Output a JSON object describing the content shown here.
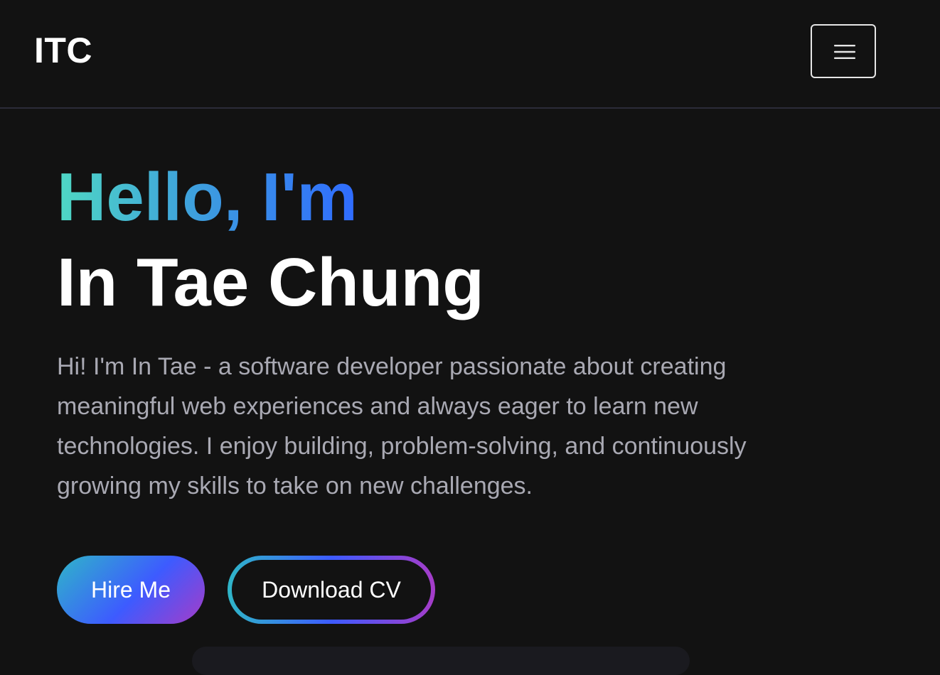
{
  "header": {
    "brand": "ITC",
    "menu_icon": "hamburger-menu-icon"
  },
  "hero": {
    "greeting": "Hello, I'm",
    "name": "In Tae Chung",
    "intro": "Hi! I'm In Tae - a software developer passionate about creating meaningful web experiences and always eager to learn new technologies. I enjoy building, problem-solving, and continuously growing my skills to take on new challenges."
  },
  "actions": {
    "hire_label": "Hire Me",
    "cv_label": "Download CV"
  },
  "colors": {
    "background": "#121212",
    "gradient_start": "#4fd8c4",
    "gradient_mid": "#3d5bff",
    "gradient_end": "#a63cc8",
    "text_muted": "#a9a9b3"
  }
}
